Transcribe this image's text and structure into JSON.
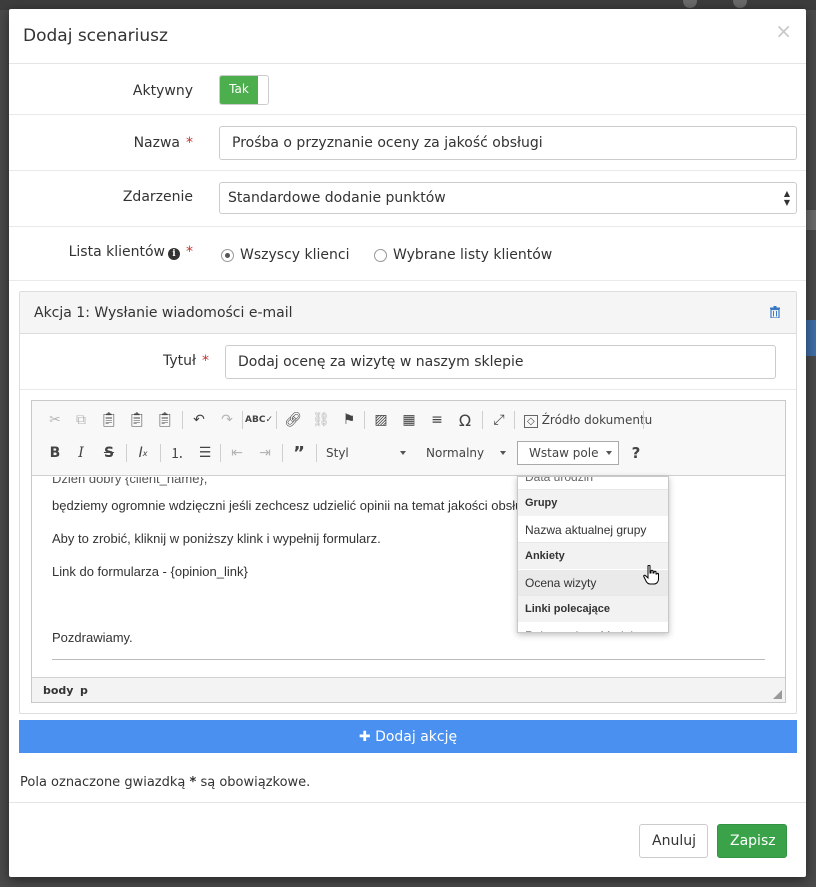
{
  "modal": {
    "title": "Dodaj scenariusz",
    "close_label": "×"
  },
  "form": {
    "active_label": "Aktywny",
    "active_value": "Tak",
    "name_label": "Nazwa",
    "name_value": "Prośba o przyznanie oceny za jakość obsługi",
    "event_label": "Zdarzenie",
    "event_value": "Standardowe dodanie punktów",
    "clients_label": "Lista klientów",
    "clients_options": [
      "Wszyscy klienci",
      "Wybrane listy klientów"
    ],
    "clients_selected": "Wszyscy klienci",
    "required_mark": "*"
  },
  "action": {
    "title": "Akcja 1: Wysłanie wiadomości e-mail",
    "subject_label": "Tytuł",
    "subject_value": "Dodaj ocenę za wizytę w naszym sklepie"
  },
  "toolbar": {
    "source_label": "Źródło dokumentu",
    "style_label": "Styl",
    "format_label": "Normalny",
    "insert_field_label": "Wstaw pole",
    "help_label": "?"
  },
  "editor": {
    "clipped_line": "Dzień dobry {client_name},",
    "lines": [
      "będziemy ogromnie wdzięczni jeśli zechcesz udzielić opinii na temat jakości obsługi",
      "Aby to zrobić, kliknij w poniższy klink i wypełnij formularz.",
      "Link do formularza - {opinion_link}",
      "Pozdrawiamy."
    ],
    "path": [
      "body",
      "p"
    ]
  },
  "dropdown": {
    "clipped_item": "Data urodzin",
    "groups": [
      {
        "name": "Grupy",
        "items": [
          "Nazwa aktualnej grupy"
        ]
      },
      {
        "name": "Ankiety",
        "items": [
          "Ocena wizyty"
        ]
      },
      {
        "name": "Linki polecające",
        "items": [
          "Rejestracja w Module ..."
        ]
      }
    ],
    "hovered": "Ocena wizyty"
  },
  "add_action_label": "Dodaj akcję",
  "legend": {
    "before": "Pola oznaczone gwiazdką",
    "star": "*",
    "after": "są obowiązkowe."
  },
  "footer": {
    "cancel_label": "Anuluj",
    "save_label": "Zapisz"
  },
  "colors": {
    "toggle_on": "#4cae4c",
    "add_action": "#4a90f0",
    "save_button": "#3aa34a",
    "required": "#c9302c"
  },
  "icons": {
    "toolbar_row1": [
      "cut-icon",
      "copy-icon",
      "paste-icon",
      "paste-text-icon",
      "paste-word-icon",
      "undo-icon",
      "redo-icon",
      "spellcheck-icon",
      "link-icon",
      "unlink-icon",
      "anchor-icon",
      "image-icon",
      "table-icon",
      "horizontal-line-icon",
      "special-char-icon",
      "maximize-icon",
      "source-icon"
    ],
    "toolbar_row2": [
      "bold-icon",
      "italic-icon",
      "strike-icon",
      "remove-format-icon",
      "numbered-list-icon",
      "bulleted-list-icon",
      "outdent-icon",
      "indent-icon",
      "blockquote-icon"
    ]
  }
}
